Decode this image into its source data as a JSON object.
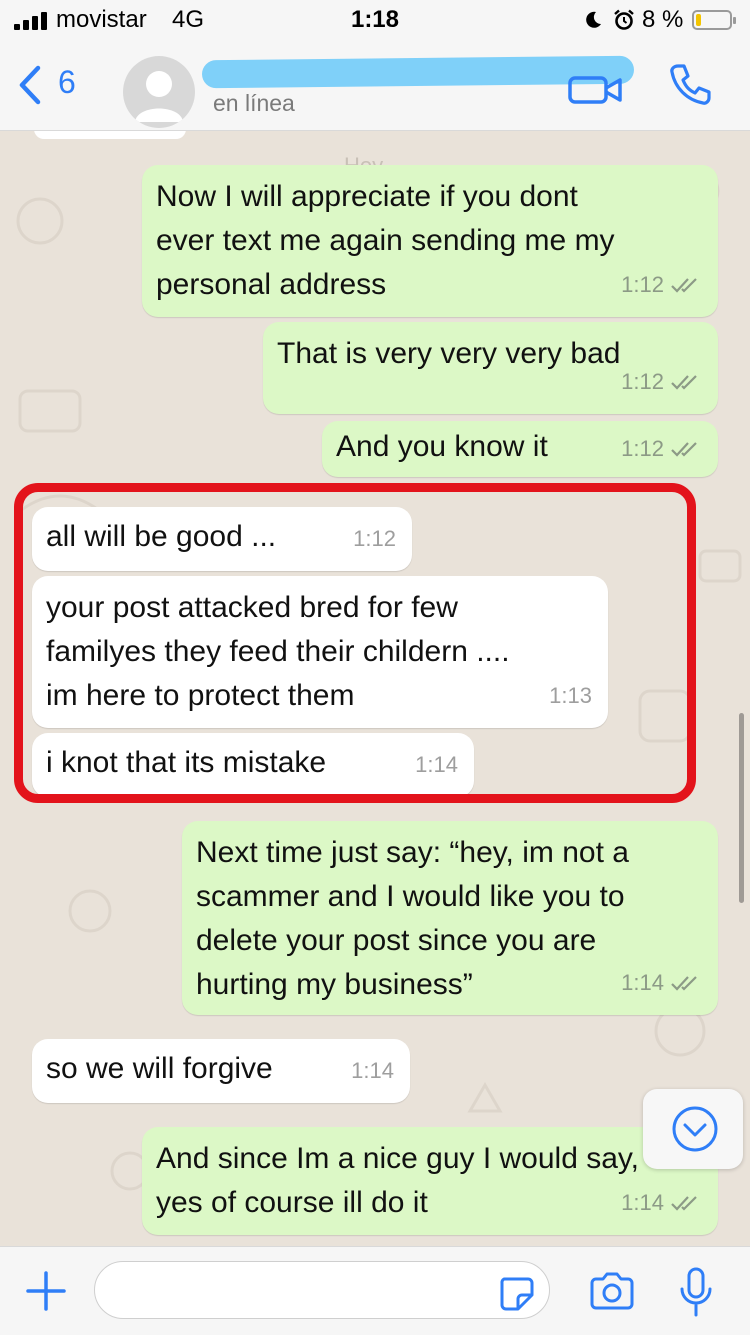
{
  "status_bar": {
    "carrier": "movistar",
    "network": "4G",
    "time": "1:18",
    "battery_percent": "8 %"
  },
  "header": {
    "back_count": "6",
    "contact_status": "en línea"
  },
  "chat": {
    "date_label": "Hoy",
    "messages": [
      {
        "direction": "outgoing",
        "text": "Now I will appreciate if you dont\never text me again sending me my\npersonal address",
        "time": "1:12",
        "read": true
      },
      {
        "direction": "outgoing",
        "text": "That is very very very bad",
        "time": "1:12",
        "read": true
      },
      {
        "direction": "outgoing",
        "text": "And you know it",
        "time": "1:12",
        "read": true
      },
      {
        "direction": "incoming",
        "text": "all will be good ...",
        "time": "1:12"
      },
      {
        "direction": "incoming",
        "text": "your post attacked bred for few\nfamilyes they feed their childern ....\nim here to protect them",
        "time": "1:13"
      },
      {
        "direction": "incoming",
        "text": "i knot that its mistake",
        "time": "1:14"
      },
      {
        "direction": "outgoing",
        "text": "Next time just say: “hey, im not a\nscammer and I would like you to\ndelete your post since you are\nhurting my business”",
        "time": "1:14",
        "read": true
      },
      {
        "direction": "incoming",
        "text": "so we will forgive",
        "time": "1:14"
      },
      {
        "direction": "outgoing",
        "text": "And since Im a nice guy I would say,\nyes of course ill do it",
        "time": "1:14",
        "read": true
      }
    ]
  },
  "composer": {
    "placeholder": ""
  },
  "colors": {
    "accent": "#2f7ef7",
    "outgoing_bubble": "#dcf8c6",
    "incoming_bubble": "#ffffff",
    "chat_background": "#e9e2d9",
    "annotation_red": "#e3131b",
    "read_ticks": "#8c9a86"
  },
  "icons": [
    "signal-icon",
    "moon-icon",
    "alarm-icon",
    "battery-icon",
    "chevron-left-icon",
    "avatar-placeholder-icon",
    "video-call-icon",
    "phone-icon",
    "double-check-icon",
    "chevron-down-circle-icon",
    "plus-icon",
    "sticker-icon",
    "camera-icon",
    "microphone-icon"
  ]
}
